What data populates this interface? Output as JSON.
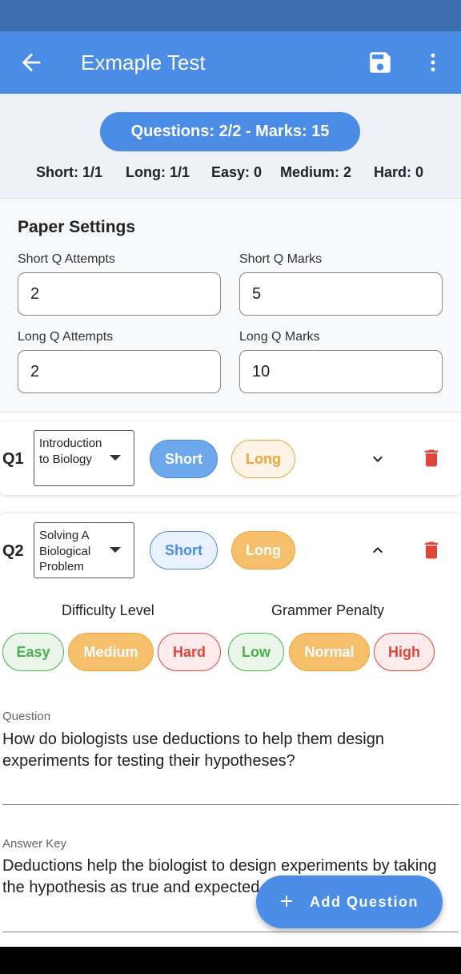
{
  "app_bar": {
    "title": "Exmaple Test",
    "back_icon": "arrow-back-icon",
    "save_icon": "save-icon",
    "more_icon": "more-vert-icon"
  },
  "summary": {
    "pill": "Questions: 2/2 - Marks: 15",
    "stats": [
      "Short: 1/1",
      "Long: 1/1",
      "Easy: 0",
      "Medium: 2",
      "Hard: 0"
    ]
  },
  "settings": {
    "heading": "Paper Settings",
    "short_attempts": {
      "label": "Short Q Attempts",
      "value": "2"
    },
    "short_marks": {
      "label": "Short Q Marks",
      "value": "5"
    },
    "long_attempts": {
      "label": "Long Q Attempts",
      "value": "2"
    },
    "long_marks": {
      "label": "Long Q Marks",
      "value": "10"
    }
  },
  "questions": [
    {
      "num": "Q1",
      "topic": "Introduction to Biology",
      "short_label": "Short",
      "long_label": "Long",
      "selected_type": "Short",
      "expanded": false
    },
    {
      "num": "Q2",
      "topic": "Solving A Biological Problem",
      "short_label": "Short",
      "long_label": "Long",
      "selected_type": "Long",
      "expanded": true,
      "difficulty_label": "Difficulty Level",
      "difficulty_options": [
        "Easy",
        "Medium",
        "Hard"
      ],
      "difficulty_selected": "Medium",
      "penalty_label": "Grammer Penalty",
      "penalty_options": [
        "Low",
        "Normal",
        "High"
      ],
      "penalty_selected": "Normal",
      "question_label": "Question",
      "question_text": "How do biologists use deductions to help them design experiments for testing their hypotheses?",
      "answer_label": "Answer Key",
      "answer_text": "Deductions help the biologist to design experiments by taking the hypothesis as true and expected results, which can then"
    }
  ],
  "fab": {
    "label": "Add Question",
    "icon": "plus-icon"
  },
  "colors": {
    "primary": "#4a8ce6",
    "status_bar": "#3d6fae",
    "orange": "#f0a53a",
    "green": "#4caf50",
    "red": "#e0453a"
  }
}
